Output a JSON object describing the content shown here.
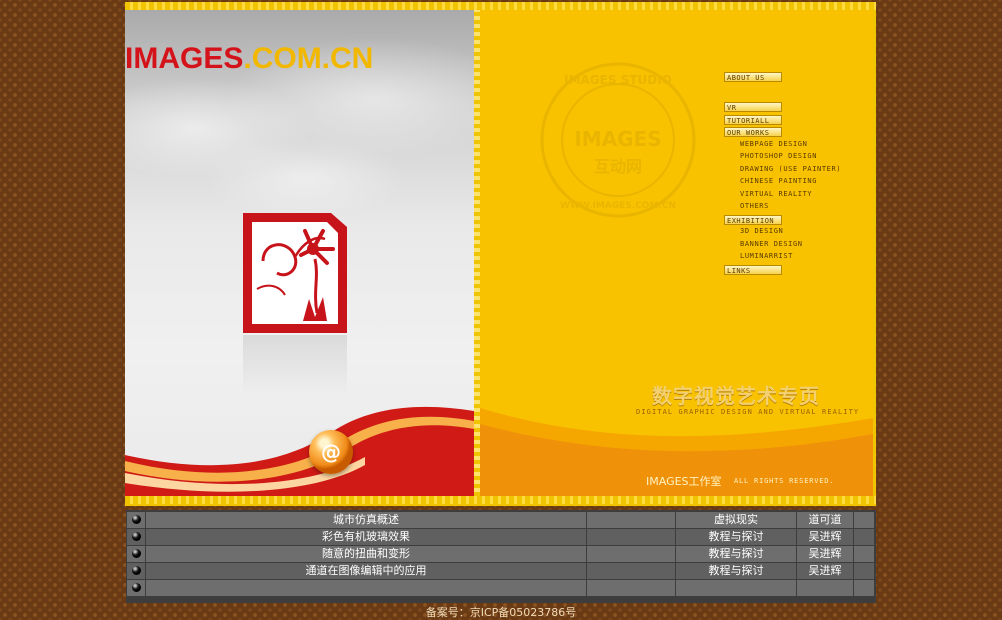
{
  "brand": {
    "part1": "IMAGES",
    "part2": ".COM.CN"
  },
  "stamp": {
    "ring_text": "IMAGES STUDIO",
    "center_top": "IMAGES",
    "center_bottom": "互动网",
    "bottom_text": "WWW.IMAGES.COM.CN"
  },
  "nav": {
    "about": "ABOUT US",
    "vr": "VR",
    "tutorial": "TUTORIALL",
    "our_works": "OUR WORKS",
    "works_items": [
      "WEBPAGE DESIGN",
      "PHOTOSHOP DESIGN",
      "DRAWING (USE PAINTER)",
      "CHINESE PAINTING",
      "VIRTUAL REALITY",
      "OTHERS"
    ],
    "exhibition": "EXHIBITION",
    "exhibition_items": [
      "3D DESIGN",
      "BANNER DESIGN",
      "LUMINARRIST"
    ],
    "links": "LINKS"
  },
  "tagline": {
    "cn": "数字视觉艺术专页",
    "en": "DIGITAL GRAPHIC DESIGN AND VIRTUAL REALITY"
  },
  "studio": {
    "name": "IMAGES工作室",
    "rights": "ALL RIGHTS RESERVED."
  },
  "articles": [
    {
      "title": "城市仿真概述",
      "category": "虚拟现实",
      "author": "道可道"
    },
    {
      "title": "彩色有机玻璃效果",
      "category": "教程与探讨",
      "author": "吴进辉"
    },
    {
      "title": "随意的扭曲和变形",
      "category": "教程与探讨",
      "author": "吴进辉"
    },
    {
      "title": "通道在图像编辑中的应用",
      "category": "教程与探讨",
      "author": "吴进辉"
    },
    {
      "title": "",
      "category": "",
      "author": ""
    }
  ],
  "footer": "备案号：京ICP备05023786号",
  "colors": {
    "brand_red": "#d4121a",
    "brand_yellow": "#f2b800",
    "panel_yellow": "#f8c200",
    "table_gray": "#6e6e6e",
    "bg_brown": "#6a3a14"
  }
}
